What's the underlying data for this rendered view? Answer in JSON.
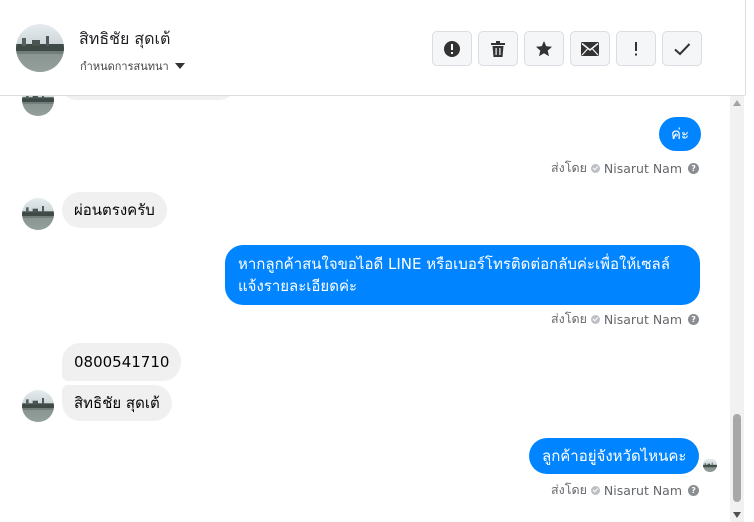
{
  "header": {
    "contact_name": "สิทธิชัย สุดเต้",
    "label_selector": "กำหนดการสนทนา",
    "toolbar": [
      {
        "name": "spam-button",
        "icon": "alert-circle-icon"
      },
      {
        "name": "delete-button",
        "icon": "trash-icon"
      },
      {
        "name": "star-button",
        "icon": "star-icon"
      },
      {
        "name": "mark-unread-button",
        "icon": "envelope-icon"
      },
      {
        "name": "follow-up-button",
        "icon": "exclamation-icon"
      },
      {
        "name": "mark-done-button",
        "icon": "checkmark-icon"
      }
    ]
  },
  "messages": [
    {
      "direction": "out",
      "text": "ค่ะ",
      "sender_prefix": "ส่งโดย",
      "sender_name": "Nisarut Nam"
    },
    {
      "direction": "in",
      "text": "ผ่อนตรงครับ"
    },
    {
      "direction": "out",
      "text_line1": "หากลูกค้าสนใจขอไอดี LINE หรือเบอร์โทรติดต่อกลับค่ะเพื่อให้เซลล์",
      "text_line2": "แจ้งรายละเอียดค่ะ",
      "sender_prefix": "ส่งโดย",
      "sender_name": "Nisarut Nam"
    },
    {
      "direction": "in",
      "text": "0800541710"
    },
    {
      "direction": "in",
      "text": "สิทธิชัย สุดเต้"
    },
    {
      "direction": "out",
      "text": "ลูกค้าอยู่จังหวัดไหนคะ",
      "sender_prefix": "ส่งโดย",
      "sender_name": "Nisarut Nam"
    }
  ],
  "colors": {
    "outgoing": "#0084ff",
    "incoming": "#f0f0f0",
    "meta": "#65676b"
  }
}
